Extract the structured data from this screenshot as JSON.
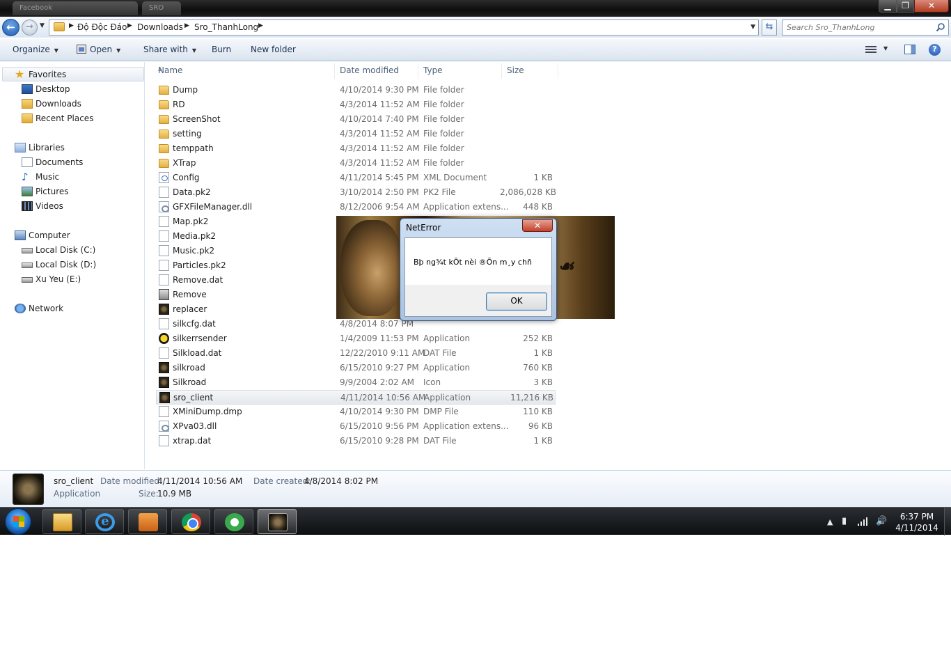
{
  "titlebar": {
    "ghost_tab": "Facebook",
    "ghost_tab2": "SRO",
    "min_glyph": "▁",
    "max_glyph": "❐",
    "close_glyph": "✕"
  },
  "address": {
    "breadcrumb": [
      "Độ Độc Đáo",
      "Downloads",
      "Sro_ThanhLong"
    ],
    "search_placeholder": "Search Sro_ThanhLong"
  },
  "toolbar": {
    "organize": "Organize",
    "open": "Open",
    "share_with": "Share with",
    "burn": "Burn",
    "new_folder": "New folder"
  },
  "nav": {
    "favorites": "Favorites",
    "desktop": "Desktop",
    "downloads": "Downloads",
    "recent_places": "Recent Places",
    "libraries": "Libraries",
    "documents": "Documents",
    "music": "Music",
    "pictures": "Pictures",
    "videos": "Videos",
    "computer": "Computer",
    "disk_c": "Local Disk (C:)",
    "disk_d": "Local Disk (D:)",
    "disk_e": "Xu Yeu (E:)",
    "network": "Network"
  },
  "columns": {
    "name": "Name",
    "date_modified": "Date modified",
    "type": "Type",
    "size": "Size"
  },
  "files": [
    {
      "name": "Dump",
      "date": "4/10/2014 9:30 PM",
      "type": "File folder",
      "size": "",
      "icon": "folder"
    },
    {
      "name": "RD",
      "date": "4/3/2014 11:52 AM",
      "type": "File folder",
      "size": "",
      "icon": "folder"
    },
    {
      "name": "ScreenShot",
      "date": "4/10/2014 7:40 PM",
      "type": "File folder",
      "size": "",
      "icon": "folder"
    },
    {
      "name": "setting",
      "date": "4/3/2014 11:52 AM",
      "type": "File folder",
      "size": "",
      "icon": "folder"
    },
    {
      "name": "temppath",
      "date": "4/3/2014 11:52 AM",
      "type": "File folder",
      "size": "",
      "icon": "folder"
    },
    {
      "name": "XTrap",
      "date": "4/3/2014 11:52 AM",
      "type": "File folder",
      "size": "",
      "icon": "folder"
    },
    {
      "name": "Config",
      "date": "4/11/2014 5:45 PM",
      "type": "XML Document",
      "size": "1 KB",
      "icon": "xml"
    },
    {
      "name": "Data.pk2",
      "date": "3/10/2014 2:50 PM",
      "type": "PK2 File",
      "size": "2,086,028 KB",
      "icon": "file"
    },
    {
      "name": "GFXFileManager.dll",
      "date": "8/12/2006 9:54 AM",
      "type": "Application extens...",
      "size": "448 KB",
      "icon": "dll"
    },
    {
      "name": "Map.pk2",
      "date": "",
      "type": "",
      "size": "",
      "icon": "file"
    },
    {
      "name": "Media.pk2",
      "date": "",
      "type": "",
      "size": "",
      "icon": "file"
    },
    {
      "name": "Music.pk2",
      "date": "",
      "type": "",
      "size": "",
      "icon": "file"
    },
    {
      "name": "Particles.pk2",
      "date": "",
      "type": "",
      "size": "",
      "icon": "file"
    },
    {
      "name": "Remove.dat",
      "date": "",
      "type": "",
      "size": "",
      "icon": "file"
    },
    {
      "name": "Remove",
      "date": "",
      "type": "",
      "size": "",
      "icon": "remove"
    },
    {
      "name": "replacer",
      "date": "",
      "type": "",
      "size": "",
      "icon": "app"
    },
    {
      "name": "silkcfg.dat",
      "date": "4/8/2014 8:07 PM",
      "type": "",
      "size": "",
      "icon": "file"
    },
    {
      "name": "silkerrsender",
      "date": "1/4/2009 11:53 PM",
      "type": "Application",
      "size": "252 KB",
      "icon": "warn"
    },
    {
      "name": "Silkload.dat",
      "date": "12/22/2010 9:11 AM",
      "type": "DAT File",
      "size": "1 KB",
      "icon": "file"
    },
    {
      "name": "silkroad",
      "date": "6/15/2010 9:27 PM",
      "type": "Application",
      "size": "760 KB",
      "icon": "app"
    },
    {
      "name": "Silkroad",
      "date": "9/9/2004 2:02 AM",
      "type": "Icon",
      "size": "3 KB",
      "icon": "app"
    },
    {
      "name": "sro_client",
      "date": "4/11/2014 10:56 AM",
      "type": "Application",
      "size": "11,216 KB",
      "icon": "app",
      "selected": true
    },
    {
      "name": "XMiniDump.dmp",
      "date": "4/10/2014 9:30 PM",
      "type": "DMP File",
      "size": "110 KB",
      "icon": "file"
    },
    {
      "name": "XPva03.dll",
      "date": "6/15/2010 9:56 PM",
      "type": "Application extens...",
      "size": "96 KB",
      "icon": "dll"
    },
    {
      "name": "xtrap.dat",
      "date": "6/15/2010 9:28 PM",
      "type": "DAT File",
      "size": "1 KB",
      "icon": "file"
    }
  ],
  "dialog": {
    "title": "NetError",
    "message": "Bþ ng¾t kÕt nèi ®Õn m¸y chñ",
    "ok": "OK",
    "close_glyph": "✕"
  },
  "details": {
    "name": "sro_client",
    "type": "Application",
    "date_modified_label": "Date modified:",
    "date_modified": "4/11/2014 10:56 AM",
    "date_created_label": "Date created:",
    "date_created": "4/8/2014 8:02 PM",
    "size_label": "Size:",
    "size": "10.9 MB"
  },
  "taskbar": {
    "time": "6:37 PM",
    "date": "4/11/2014"
  }
}
